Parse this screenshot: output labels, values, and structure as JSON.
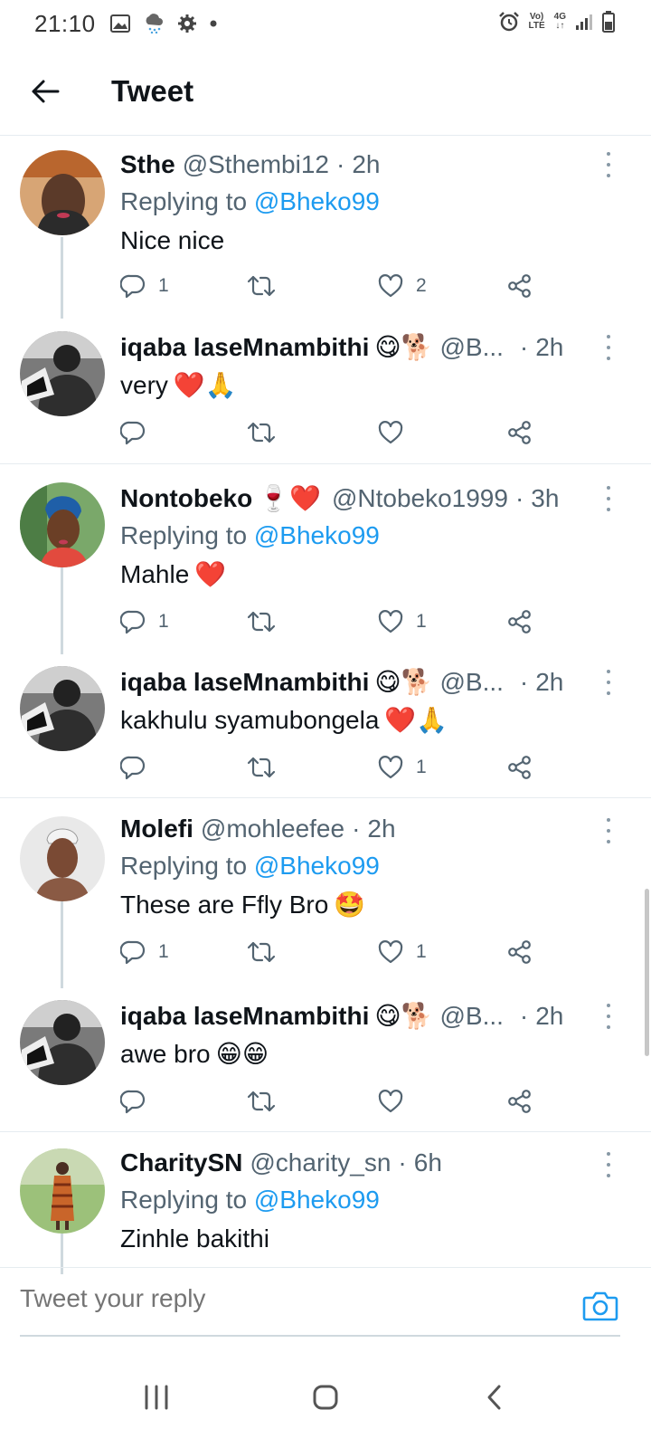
{
  "status_bar": {
    "time": "21:10",
    "left_icons": [
      "image-icon",
      "weather-icon",
      "settings-icon",
      "dot-icon"
    ],
    "volte_label_top": "Vo)",
    "volte_label_bottom": "LTE",
    "network_label_top": "4G",
    "network_label_bottom": "↓↑"
  },
  "header": {
    "title": "Tweet"
  },
  "tweets": [
    {
      "name": "Sthe",
      "handle": "@Sthembi12",
      "time": "2h",
      "reply_prefix": "Replying to",
      "reply_mention": "@Bheko99",
      "text": "Nice nice",
      "text_emojis": [],
      "reply_count": "1",
      "retweet_count": "",
      "like_count": "2",
      "liked": false
    },
    {
      "name": "iqaba laseMnambithi",
      "name_emojis": "😋🐕",
      "handle": "@B...",
      "time": "2h",
      "text": "very",
      "text_emojis": "❤️🙏",
      "reply_count": "",
      "retweet_count": "",
      "like_count": ""
    },
    {
      "name": "Nontobeko",
      "name_emojis": "🍷❤️",
      "handle": "@Ntobeko1999",
      "time": "3h",
      "reply_prefix": "Replying to",
      "reply_mention": "@Bheko99",
      "text": "Mahle",
      "text_emojis": "❤️",
      "reply_count": "1",
      "retweet_count": "",
      "like_count": "1"
    },
    {
      "name": "iqaba laseMnambithi",
      "name_emojis": "😋🐕",
      "handle": "@B...",
      "time": "2h",
      "text": "kakhulu syamubongela",
      "text_emojis": "❤️🙏",
      "reply_count": "",
      "retweet_count": "",
      "like_count": "1"
    },
    {
      "name": "Molefi",
      "handle": "@mohleefee",
      "time": "2h",
      "reply_prefix": "Replying to",
      "reply_mention": "@Bheko99",
      "text": "These are Ffly Bro",
      "text_emojis": "🤩",
      "reply_count": "1",
      "retweet_count": "",
      "like_count": "1"
    },
    {
      "name": "iqaba laseMnambithi",
      "name_emojis": "😋🐕",
      "handle": "@B...",
      "time": "2h",
      "text": "awe bro",
      "text_emojis": "😁😁",
      "reply_count": "",
      "retweet_count": "",
      "like_count": ""
    },
    {
      "name": "CharitySN",
      "handle": "@charity_sn",
      "time": "6h",
      "reply_prefix": "Replying to",
      "reply_mention": "@Bheko99",
      "text": "Zinhle bakithi"
    }
  ],
  "reply_bar": {
    "placeholder": "Tweet your reply"
  },
  "colors": {
    "accent": "#1d9bf0",
    "muted": "#536471",
    "text": "#0f1419",
    "divider": "#e6ecf0"
  }
}
